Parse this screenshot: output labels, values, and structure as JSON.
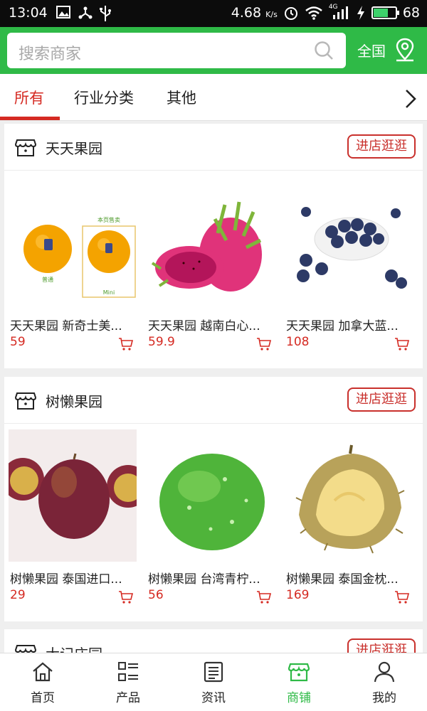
{
  "status_bar": {
    "time": "13:04",
    "speed": "4.68",
    "speed_unit": "K/s",
    "network": "4G",
    "battery": "68",
    "battery_level": 0.68,
    "icons": [
      "image-icon",
      "usb-share-icon",
      "usb-icon",
      "alarm-icon",
      "wifi-icon",
      "signal-icon",
      "charging-icon",
      "battery-icon"
    ]
  },
  "header": {
    "search_placeholder": "搜索商家",
    "region_label": "全国",
    "accent_color": "#2fba47"
  },
  "tabs": [
    {
      "label": "所有",
      "active": true
    },
    {
      "label": "行业分类",
      "active": false
    },
    {
      "label": "其他",
      "active": false
    }
  ],
  "stores": [
    {
      "name": "天天果园",
      "visit_label": "进店逛逛",
      "products": [
        {
          "title": "天天果园 新奇士美...",
          "price": "59",
          "image": "orange-image",
          "image_text_top": "本页售卖",
          "image_text_left": "普通",
          "image_text_right": "Mini"
        },
        {
          "title": "天天果园 越南白心...",
          "price": "59.9",
          "image": "dragon-fruit-image"
        },
        {
          "title": "天天果园 加拿大蓝...",
          "price": "108",
          "image": "blueberry-image"
        }
      ]
    },
    {
      "name": "树懒果园",
      "visit_label": "进店逛逛",
      "products": [
        {
          "title": "树懒果园 泰国进口...",
          "price": "29",
          "image": "passion-fruit-image"
        },
        {
          "title": "树懒果园 台湾青柠...",
          "price": "56",
          "image": "lime-image"
        },
        {
          "title": "树懒果园 泰国金枕...",
          "price": "169",
          "image": "durian-image"
        }
      ]
    },
    {
      "name": "大记庄园",
      "visit_label": "进店逛逛",
      "products": []
    }
  ],
  "bottom_nav": [
    {
      "label": "首页",
      "icon": "home-icon",
      "active": false
    },
    {
      "label": "产品",
      "icon": "product-list-icon",
      "active": false
    },
    {
      "label": "资讯",
      "icon": "news-icon",
      "active": false
    },
    {
      "label": "商铺",
      "icon": "store-icon",
      "active": true
    },
    {
      "label": "我的",
      "icon": "profile-icon",
      "active": false
    }
  ],
  "colors": {
    "brand_green": "#2fba47",
    "price_red": "#d52a22",
    "button_red": "#c9302c"
  }
}
